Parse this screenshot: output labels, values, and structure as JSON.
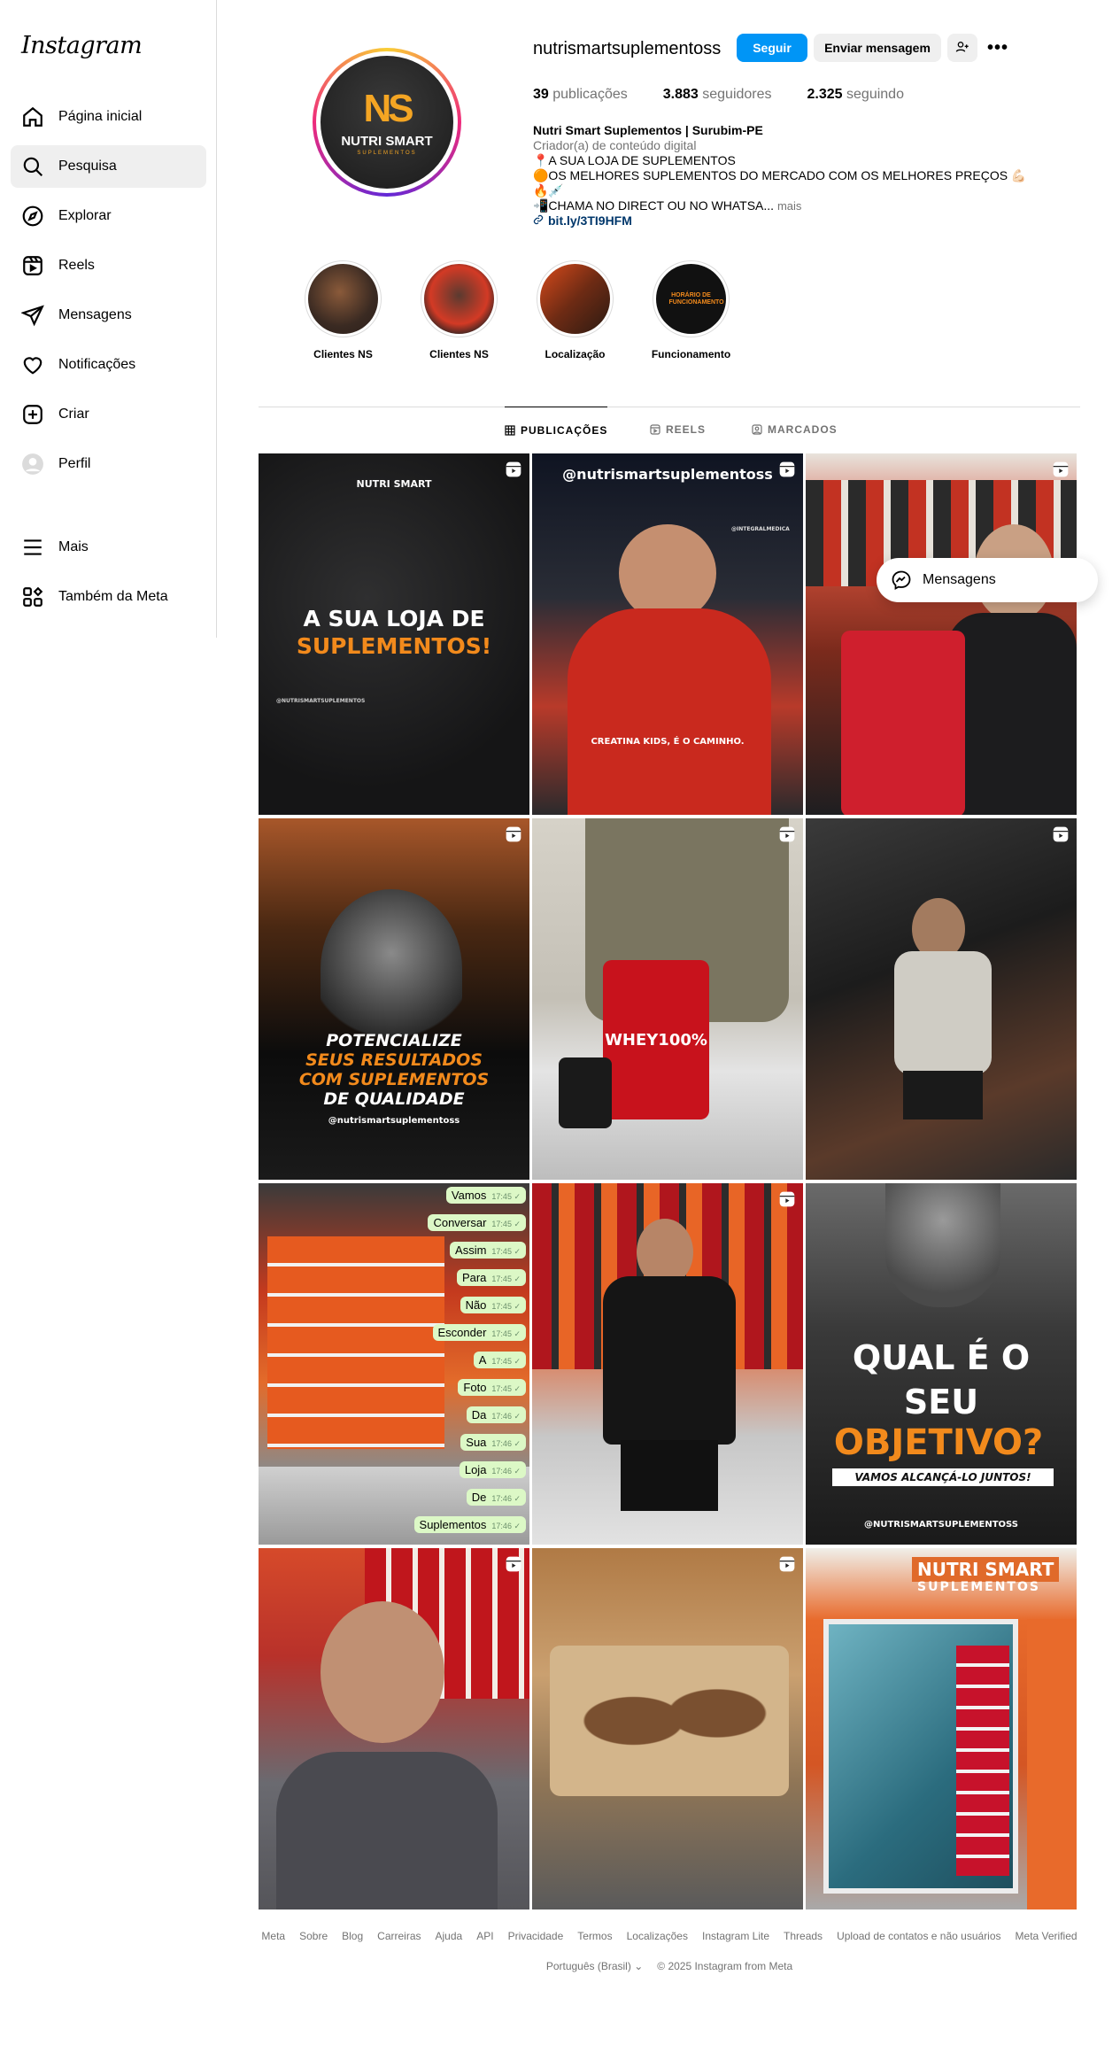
{
  "app": {
    "logo": "Instagram"
  },
  "sidebar": {
    "items": [
      {
        "label": "Página inicial",
        "icon": "home-icon"
      },
      {
        "label": "Pesquisa",
        "icon": "search-icon"
      },
      {
        "label": "Explorar",
        "icon": "explore-icon"
      },
      {
        "label": "Reels",
        "icon": "reels-icon"
      },
      {
        "label": "Mensagens",
        "icon": "messages-icon"
      },
      {
        "label": "Notificações",
        "icon": "heart-icon"
      },
      {
        "label": "Criar",
        "icon": "create-icon"
      },
      {
        "label": "Perfil",
        "icon": "profile-avatar"
      }
    ],
    "bottom": [
      {
        "label": "Mais",
        "icon": "menu-icon"
      },
      {
        "label": "Também da Meta",
        "icon": "meta-apps-icon"
      }
    ]
  },
  "profile": {
    "username": "nutrismartsuplementoss",
    "avatar": {
      "monogram": "NS",
      "brand": "NUTRI SMART",
      "sub": "SUPLEMENTOS"
    },
    "buttons": {
      "follow": "Seguir",
      "message": "Enviar mensagem",
      "more": "•••"
    },
    "stats": {
      "posts_count": "39",
      "posts_label": "publicações",
      "followers_count": "3.883",
      "followers_label": "seguidores",
      "following_count": "2.325",
      "following_label": "seguindo"
    },
    "bio": {
      "name": "Nutri Smart Suplementos | Surubim-PE",
      "category": "Criador(a) de conteúdo digital",
      "line1": "📍A SUA LOJA DE SUPLEMENTOS",
      "line2": "🟠OS MELHORES SUPLEMENTOS DO MERCADO COM OS MELHORES PREÇOS 💪🏻🔥💉",
      "line3": "📲CHAMA NO DIRECT OU NO WHATSA...",
      "more": "mais",
      "link": "bit.ly/3TI9HFM"
    }
  },
  "highlights": [
    {
      "label": "Clientes NS"
    },
    {
      "label": "Clientes NS"
    },
    {
      "label": "Localização"
    },
    {
      "label": "Funcionamento"
    }
  ],
  "highlight_overlay": {
    "title": "HORÁRIO DE FUNCIONAMENTO"
  },
  "tabs": [
    {
      "label": "PUBLICAÇÕES"
    },
    {
      "label": "REELS"
    },
    {
      "label": "MARCADOS"
    }
  ],
  "posts": {
    "p1": {
      "brand": "NUTRI SMART",
      "line1": "A SUA LOJA DE",
      "line2": "SUPLEMENTOS!",
      "handle": "@NUTRISMARTSUPLEMENTOS"
    },
    "p2": {
      "handle": "@nutrismartsuplementoss",
      "sub_handle": "@INTEGRALMEDICA",
      "caption": "CREATINA KIDS, É O CAMINHO."
    },
    "p4": {
      "line1": "POTENCIALIZE",
      "line2": "SEUS RESULTADOS",
      "line3": "COM SUPLEMENTOS",
      "line4": "DE QUALIDADE",
      "handle": "@nutrismartsuplementoss"
    },
    "p5": {
      "product": "WHEY100%"
    },
    "p7": {
      "messages": [
        {
          "text": "Vamos",
          "time": "17:45 ✓"
        },
        {
          "text": "Conversar",
          "time": "17:45 ✓"
        },
        {
          "text": "Assim",
          "time": "17:45 ✓"
        },
        {
          "text": "Para",
          "time": "17:45 ✓"
        },
        {
          "text": "Não",
          "time": "17:45 ✓"
        },
        {
          "text": "Esconder",
          "time": "17:45 ✓"
        },
        {
          "text": "A",
          "time": "17:45 ✓"
        },
        {
          "text": "Foto",
          "time": "17:45 ✓"
        },
        {
          "text": "Da",
          "time": "17:46 ✓"
        },
        {
          "text": "Sua",
          "time": "17:46 ✓"
        },
        {
          "text": "Loja",
          "time": "17:46 ✓"
        },
        {
          "text": "De",
          "time": "17:46 ✓"
        },
        {
          "text": "Suplementos",
          "time": "17:46 ✓"
        }
      ]
    },
    "p9": {
      "line1": "QUAL É O",
      "line2": "SEU",
      "line3": "OBJETIVO?",
      "line4": "VAMOS ALCANÇÁ-LO JUNTOS!",
      "handle": "@NUTRISMARTSUPLEMENTOSS"
    },
    "p12": {
      "sign1": "NUTRI SMART",
      "sign2": "SUPLEMENTOS"
    }
  },
  "floating": {
    "messages": "Mensagens"
  },
  "footer": {
    "links": [
      "Meta",
      "Sobre",
      "Blog",
      "Carreiras",
      "Ajuda",
      "API",
      "Privacidade",
      "Termos",
      "Localizações",
      "Instagram Lite",
      "Threads",
      "Upload de contatos e não usuários",
      "Meta Verified"
    ],
    "language": "Português (Brasil)",
    "copyright": "© 2025 Instagram from Meta"
  },
  "colors": {
    "primary_button": "#0095f6",
    "link": "#00376b",
    "muted": "#737373",
    "orange": "#f28a1c"
  }
}
